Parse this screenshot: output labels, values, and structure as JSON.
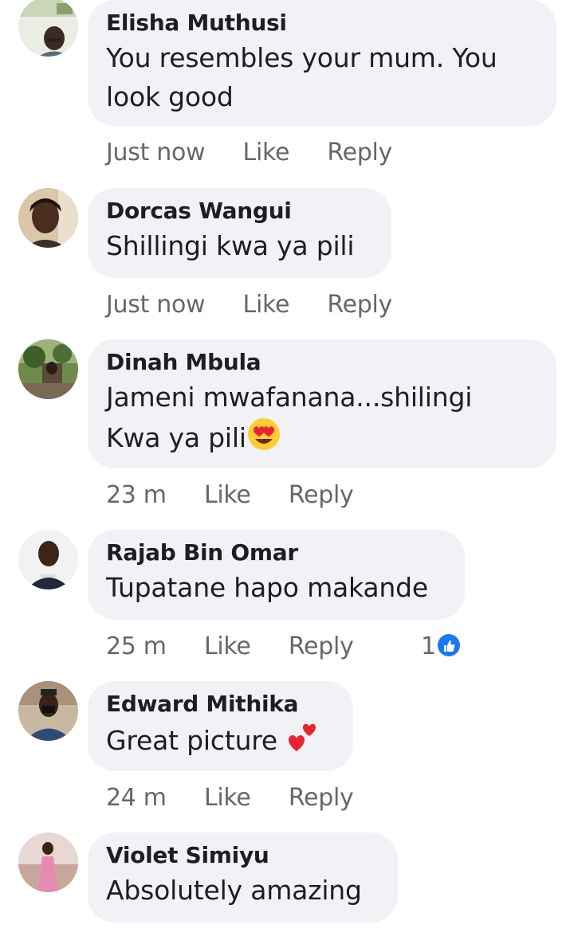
{
  "comments": [
    {
      "author": "Elisha Muthusi",
      "text_lines": [
        "You resembles your mum.  You",
        "look good"
      ],
      "time": "Just now",
      "like": "Like",
      "reply": "Reply",
      "avatar": "avatar-photo"
    },
    {
      "author": "Dorcas Wangui",
      "text_lines": [
        "Shillingi kwa ya pili"
      ],
      "time": "Just now",
      "like": "Like",
      "reply": "Reply",
      "avatar": "avatar-photo"
    },
    {
      "author": "Dinah Mbula",
      "text_lines": [
        "Jameni mwafanana...shilingi",
        "Kwa ya pili"
      ],
      "emoji": "heart-eyes-emoji",
      "time": "23 m",
      "like": "Like",
      "reply": "Reply",
      "avatar": "avatar-photo"
    },
    {
      "author": "Rajab Bin Omar",
      "text_lines": [
        "Tupatane hapo makande"
      ],
      "time": "25 m",
      "like": "Like",
      "reply": "Reply",
      "reaction_count": "1",
      "reaction_icon": "like-reaction-icon",
      "avatar": "avatar-photo"
    },
    {
      "author": "Edward Mithika",
      "text_lines": [
        "Great picture "
      ],
      "emoji": "two-hearts-emoji",
      "time": "24 m",
      "like": "Like",
      "reply": "Reply",
      "avatar": "avatar-photo"
    },
    {
      "author": "Violet Simiyu",
      "text_lines": [
        "Absolutely amazing"
      ],
      "avatar": "avatar-photo"
    }
  ],
  "colors": {
    "bubble": "#f0f2f5",
    "text": "#1c1e21",
    "meta": "#65676b",
    "like_blue": "#1877f2"
  }
}
